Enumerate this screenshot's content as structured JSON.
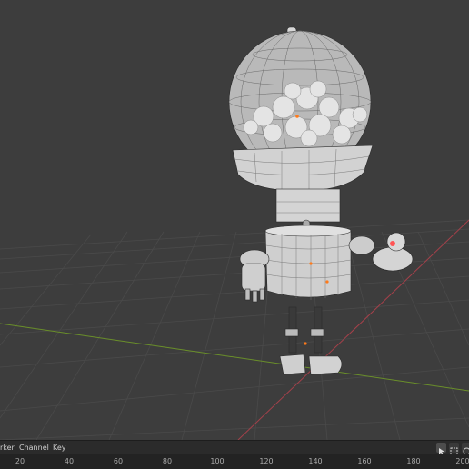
{
  "timeline_menu": {
    "marker_label": "rker",
    "channel_label": "Channel",
    "key_label": "Key"
  },
  "ruler_ticks": [
    "20",
    "40",
    "60",
    "80",
    "100",
    "120",
    "140",
    "160",
    "180",
    "200"
  ],
  "icons": {
    "select_tool": "cursor-arrow-icon",
    "select_box": "box-select-icon",
    "overlay": "overlay-icon"
  },
  "colors": {
    "viewport_bg": "#3d3d3d",
    "grid_line": "#4a4a4a",
    "x_axis": "#a3404a",
    "y_axis": "#6a8f2a",
    "header_bg": "#2b2b2b",
    "ruler_bg": "#232323"
  }
}
